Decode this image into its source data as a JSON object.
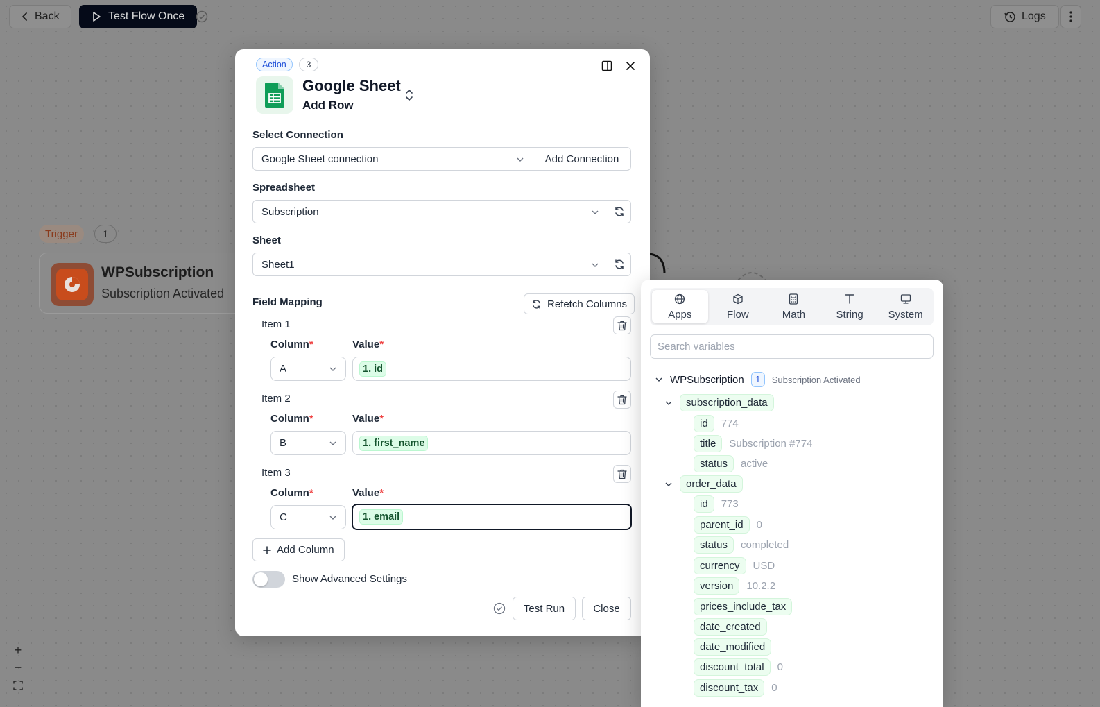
{
  "topbar": {
    "back_label": "Back",
    "test_flow_label": "Test Flow Once",
    "logs_label": "Logs"
  },
  "trigger": {
    "badge": "Trigger",
    "number": "1",
    "title": "WPSubscription",
    "subtitle": "Subscription Activated"
  },
  "modal": {
    "badge": "Action",
    "step_number": "3",
    "app_name": "Google Sheet",
    "action_name": "Add Row",
    "connection": {
      "label": "Select Connection",
      "value": "Google Sheet connection",
      "add_button": "Add Connection"
    },
    "spreadsheet": {
      "label": "Spreadsheet",
      "value": "Subscription"
    },
    "sheet": {
      "label": "Sheet",
      "value": "Sheet1"
    },
    "field_mapping": {
      "label": "Field Mapping",
      "refetch_button": "Refetch Columns",
      "column_label": "Column",
      "value_label": "Value",
      "required_mark": "*",
      "items": [
        {
          "label": "Item 1",
          "column": "A",
          "value": "1. id"
        },
        {
          "label": "Item 2",
          "column": "B",
          "value": "1. first_name"
        },
        {
          "label": "Item 3",
          "column": "C",
          "value": "1. email"
        }
      ],
      "add_column_button": "Add Column"
    },
    "advanced_toggle_label": "Show Advanced Settings",
    "advanced_enabled": false,
    "test_run_button": "Test Run",
    "close_button": "Close"
  },
  "variables_panel": {
    "tabs": [
      {
        "label": "Apps",
        "icon": "globe-icon",
        "active": true
      },
      {
        "label": "Flow",
        "icon": "cube-icon",
        "active": false
      },
      {
        "label": "Math",
        "icon": "calculator-icon",
        "active": false
      },
      {
        "label": "String",
        "icon": "text-icon",
        "active": false
      },
      {
        "label": "System",
        "icon": "monitor-icon",
        "active": false
      }
    ],
    "search_placeholder": "Search variables",
    "source": {
      "name": "WPSubscription",
      "number": "1",
      "event": "Subscription Activated"
    },
    "groups": [
      {
        "name": "subscription_data",
        "fields": [
          {
            "key": "id",
            "value": "774"
          },
          {
            "key": "title",
            "value": "Subscription #774"
          },
          {
            "key": "status",
            "value": "active"
          }
        ]
      },
      {
        "name": "order_data",
        "fields": [
          {
            "key": "id",
            "value": "773"
          },
          {
            "key": "parent_id",
            "value": "0"
          },
          {
            "key": "status",
            "value": "completed"
          },
          {
            "key": "currency",
            "value": "USD"
          },
          {
            "key": "version",
            "value": "10.2.2"
          },
          {
            "key": "prices_include_tax",
            "value": ""
          },
          {
            "key": "date_created",
            "value": ""
          },
          {
            "key": "date_modified",
            "value": ""
          },
          {
            "key": "discount_total",
            "value": "0"
          },
          {
            "key": "discount_tax",
            "value": "0"
          }
        ]
      }
    ]
  },
  "zoom_controls": {
    "zoom_in": "+",
    "zoom_out": "−"
  }
}
